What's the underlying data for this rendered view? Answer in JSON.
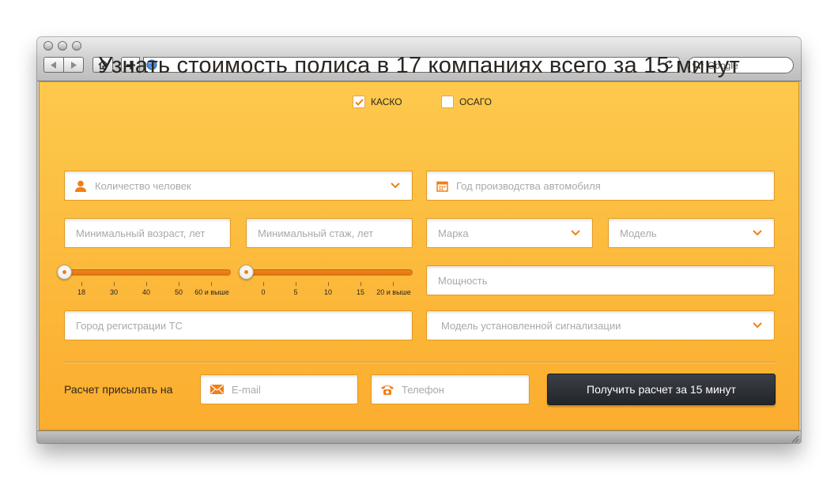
{
  "browser": {
    "search_placeholder": "Google"
  },
  "page": {
    "headline": "Узнать стоимость полиса в 17 компаниях всего за 15 минут",
    "insurance_types": [
      {
        "label": "КАСКО",
        "checked": true
      },
      {
        "label": "ОСАГО",
        "checked": false
      }
    ],
    "fields": {
      "people_count": "Количество человек",
      "car_year": "Год производства автомобиля",
      "min_age": "Минимальный возраст, лет",
      "min_experience": "Минимальный стаж, лет",
      "brand": "Марка",
      "model": "Модель",
      "power": "Мощность",
      "registration_city": "Город регистрации ТС",
      "alarm_model": "Модель установленной сигнализации"
    },
    "age_slider": {
      "ticks": [
        "18",
        "30",
        "40",
        "50",
        "60 и выше"
      ],
      "value": "18"
    },
    "experience_slider": {
      "ticks": [
        "0",
        "5",
        "10",
        "15",
        "20 и выше"
      ],
      "value": "0"
    },
    "contact": {
      "send_label": "Расчет присылать на",
      "email_placeholder": "E-mail",
      "phone_placeholder": "Телефон"
    },
    "submit_label": "Получить расчет за 15 минут"
  },
  "colors": {
    "accent": "#f07f17",
    "background_top": "#fdc94d",
    "background_bottom": "#fbad2e",
    "button": "#2a2d33"
  }
}
